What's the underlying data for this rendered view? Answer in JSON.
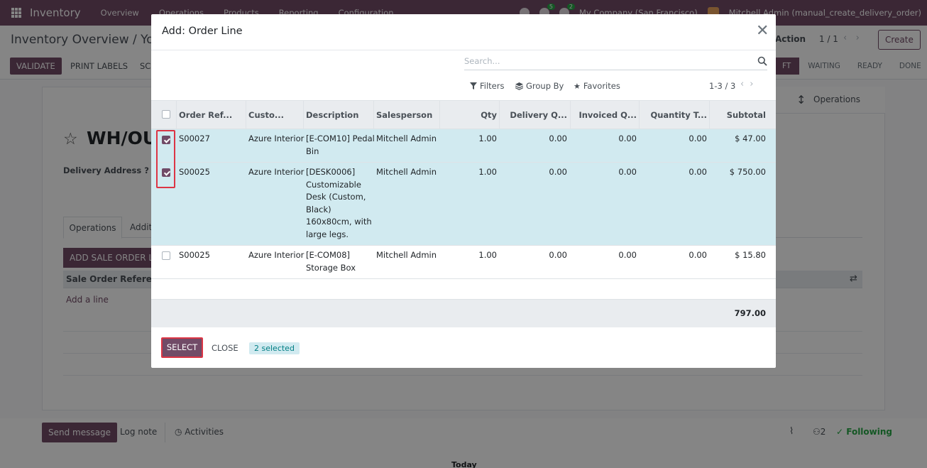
{
  "app": {
    "name": "Inventory",
    "nav": [
      "Overview",
      "Operations",
      "Products",
      "Reporting",
      "Configuration"
    ],
    "company": "My Company (San Francisco)",
    "user": "Mitchell Admin (manual_create_delivery_order)",
    "badge_messages": "5",
    "badge_activities": "2"
  },
  "control_panel": {
    "breadcrumb": "Inventory Overview / Your",
    "action": "Action",
    "pager": "1 / 1",
    "create": "Create",
    "validate": "Validate",
    "print_labels": "Print Labels",
    "sc": "SC",
    "status": [
      "Draft",
      "Waiting",
      "Ready",
      "Done"
    ],
    "status_visible": [
      "FT",
      "WAITING",
      "READY",
      "DONE"
    ]
  },
  "form": {
    "title": "WH/OUT",
    "delivery_label": "Delivery Address ?",
    "smart_button": "Operations",
    "tabs": [
      "Operations",
      "Additi"
    ],
    "add_sale_order_line": "ADD SALE ORDER LIN",
    "subtable_header": "Sale Order Reference",
    "add_line": "Add a line"
  },
  "chatter": {
    "send_message": "Send message",
    "log_note": "Log note",
    "activities": "Activities",
    "followers": "2",
    "following": "Following",
    "today": "Today"
  },
  "modal": {
    "title": "Add: Order Line",
    "search_placeholder": "Search...",
    "filters": "Filters",
    "group_by": "Group By",
    "favorites": "Favorites",
    "pager": "1-3 / 3",
    "columns": [
      "Order Ref...",
      "Custo...",
      "Description",
      "Salesperson",
      "Qty",
      "Delivery Q...",
      "Invoiced Q...",
      "Quantity T...",
      "Subtotal"
    ],
    "rows": [
      {
        "selected": true,
        "order_ref": "S00027",
        "customer": "Azure Interior",
        "description": [
          "[E-COM10] Pedal",
          "Bin"
        ],
        "salesperson": "Mitchell Admin",
        "qty": "1.00",
        "delivered": "0.00",
        "invoiced": "0.00",
        "quantity_t": "0.00",
        "subtotal": "$ 47.00"
      },
      {
        "selected": true,
        "order_ref": "S00025",
        "customer": "Azure Interior",
        "description": [
          "[DESK0006]",
          "Customizable",
          "Desk (Custom,",
          "Black)",
          "160x80cm, with",
          "large legs."
        ],
        "salesperson": "Mitchell Admin",
        "qty": "1.00",
        "delivered": "0.00",
        "invoiced": "0.00",
        "quantity_t": "0.00",
        "subtotal": "$ 750.00"
      },
      {
        "selected": false,
        "order_ref": "S00025",
        "customer": "Azure Interior",
        "description": [
          "[E-COM08]",
          "Storage Box"
        ],
        "salesperson": "Mitchell Admin",
        "qty": "1.00",
        "delivered": "0.00",
        "invoiced": "0.00",
        "quantity_t": "0.00",
        "subtotal": "$ 15.80"
      }
    ],
    "total": "797.00",
    "select_button": "SELECT",
    "close_button": "CLOSE",
    "selected_badge": "2 selected"
  },
  "colors": {
    "brand": "#714b67",
    "selected_row": "#d1eaf0",
    "highlight": "#dc3545"
  }
}
